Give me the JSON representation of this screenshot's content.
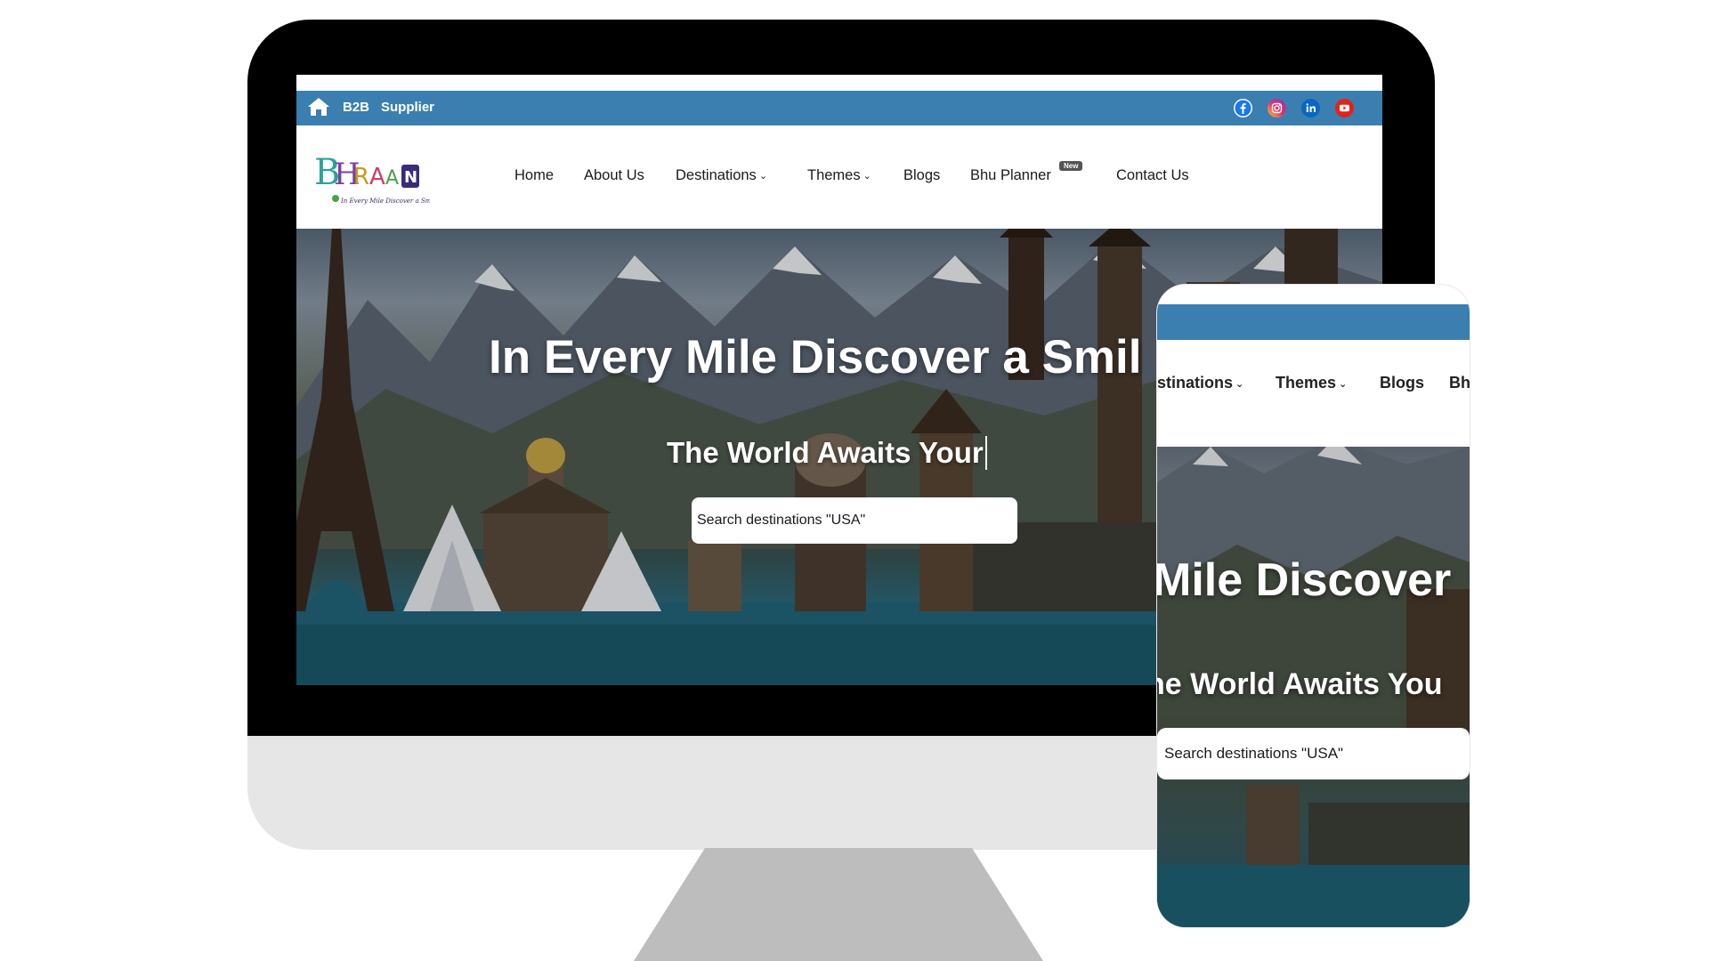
{
  "topbar": {
    "links": [
      "B2B",
      "Supplier"
    ],
    "social": [
      {
        "icon": "facebook-icon",
        "color": "#1877f2"
      },
      {
        "icon": "instagram-icon",
        "color": "#d6249f"
      },
      {
        "icon": "linkedin-icon",
        "color": "#0a66c2"
      },
      {
        "icon": "youtube-icon",
        "color": "#e62117"
      }
    ],
    "color": "#3a7fb0"
  },
  "logo": {
    "text": "BHRAMAN",
    "tagline": "In Every Mile Discover a Smile"
  },
  "nav": {
    "home": "Home",
    "about": "About Us",
    "destinations": "Destinations",
    "themes": "Themes",
    "blogs": "Blogs",
    "planner": "Bhu Planner",
    "planner_badge": "New",
    "contact": "Contact Us"
  },
  "hero": {
    "title": "In Every Mile Discover a Smil",
    "subtitle": "The World Awaits Your",
    "search_placeholder": "Search destinations \"USA\""
  },
  "mobile": {
    "nav": {
      "destinations": "stinations",
      "themes": "Themes",
      "blogs": "Blogs",
      "more": "Bh"
    },
    "title": "Mile Discover",
    "subtitle": "ne World Awaits You",
    "search_placeholder": "Search destinations \"USA\""
  }
}
